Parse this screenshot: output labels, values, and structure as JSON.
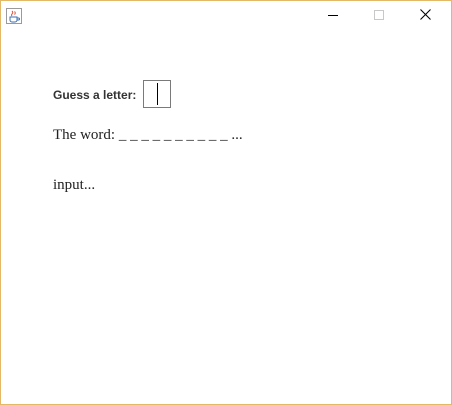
{
  "window": {
    "icon": "java-cup-icon",
    "controls": {
      "minimize": "minimize-icon",
      "maximize": "maximize-icon",
      "close": "close-icon"
    }
  },
  "form": {
    "prompt_label": "Guess a letter:",
    "letter_value": ""
  },
  "word": {
    "prefix": "The word:",
    "masked": "_ _ _ _ _ _ _ _ _ _",
    "suffix": "..."
  },
  "status": {
    "text": "input..."
  },
  "colors": {
    "window_border": "#e3b968",
    "background": "#ffffff",
    "text": "#222222"
  }
}
